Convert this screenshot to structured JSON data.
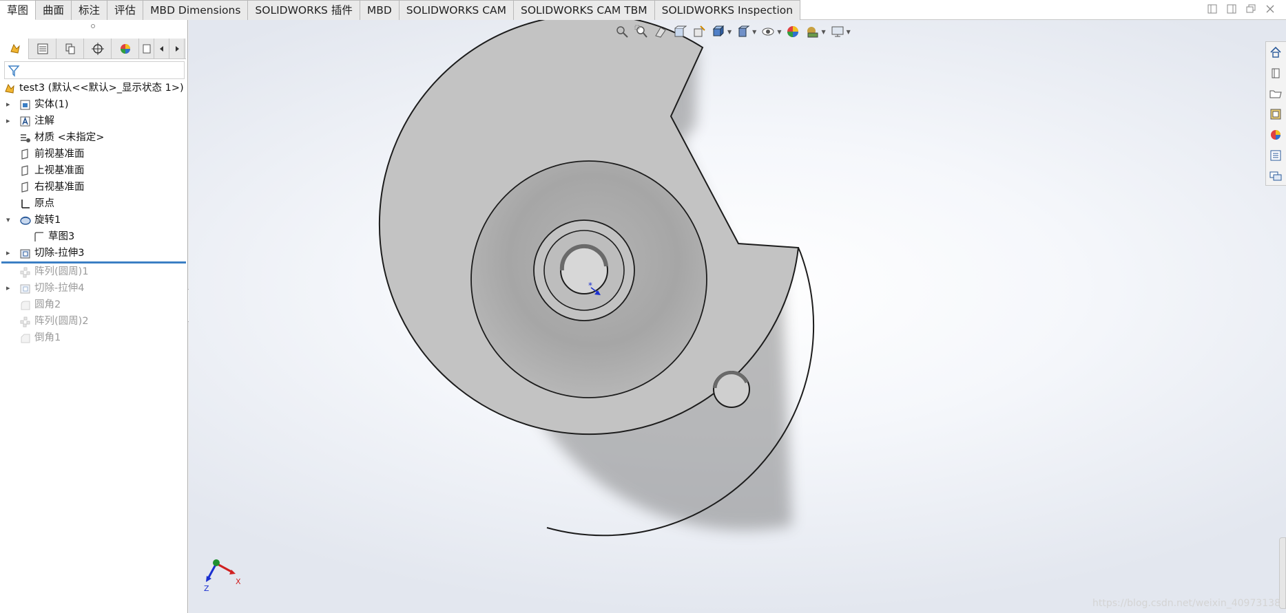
{
  "tabs": [
    "草图",
    "曲面",
    "标注",
    "评估",
    "MBD Dimensions",
    "SOLIDWORKS 插件",
    "MBD",
    "SOLIDWORKS CAM",
    "SOLIDWORKS CAM TBM",
    "SOLIDWORKS Inspection"
  ],
  "active_tab": "草图",
  "tree": {
    "root": "test3  (默认<<默认>_显示状态 1>)",
    "items": [
      {
        "label": "实体(1)",
        "icon": "solid-bodies-icon",
        "expand": "collapsed",
        "state": "normal"
      },
      {
        "label": "注解",
        "icon": "annotations-icon",
        "expand": "collapsed",
        "state": "normal"
      },
      {
        "label": "材质 <未指定>",
        "icon": "material-icon",
        "expand": "none",
        "state": "normal"
      },
      {
        "label": "前视基准面",
        "icon": "plane-icon",
        "expand": "none",
        "state": "normal"
      },
      {
        "label": "上视基准面",
        "icon": "plane-icon",
        "expand": "none",
        "state": "normal"
      },
      {
        "label": "右视基准面",
        "icon": "plane-icon",
        "expand": "none",
        "state": "normal"
      },
      {
        "label": "原点",
        "icon": "origin-icon",
        "expand": "none",
        "state": "normal"
      },
      {
        "label": "旋转1",
        "icon": "revolve-icon",
        "expand": "expanded",
        "state": "normal"
      },
      {
        "label": "草图3",
        "icon": "sketch-icon",
        "expand": "none",
        "state": "normal",
        "child": true
      },
      {
        "label": "切除-拉伸3",
        "icon": "cut-extrude-icon",
        "expand": "collapsed",
        "state": "normal"
      },
      {
        "label": "阵列(圆周)1",
        "icon": "circular-pattern-icon",
        "expand": "none",
        "state": "suppressed"
      },
      {
        "label": "切除-拉伸4",
        "icon": "cut-extrude-icon",
        "expand": "collapsed",
        "state": "suppressed"
      },
      {
        "label": "圆角2",
        "icon": "fillet-icon",
        "expand": "none",
        "state": "suppressed"
      },
      {
        "label": "阵列(圆周)2",
        "icon": "circular-pattern-icon",
        "expand": "none",
        "state": "suppressed"
      },
      {
        "label": "倒角1",
        "icon": "chamfer-icon",
        "expand": "none",
        "state": "suppressed"
      }
    ]
  },
  "triad": {
    "x": "X",
    "z": "Z"
  },
  "watermark": "https://blog.csdn.net/weixin_40973138",
  "colors": {
    "accent": "#3b7fc4",
    "part_face": "#c0c0c0",
    "part_edge": "#1a1a1a"
  }
}
